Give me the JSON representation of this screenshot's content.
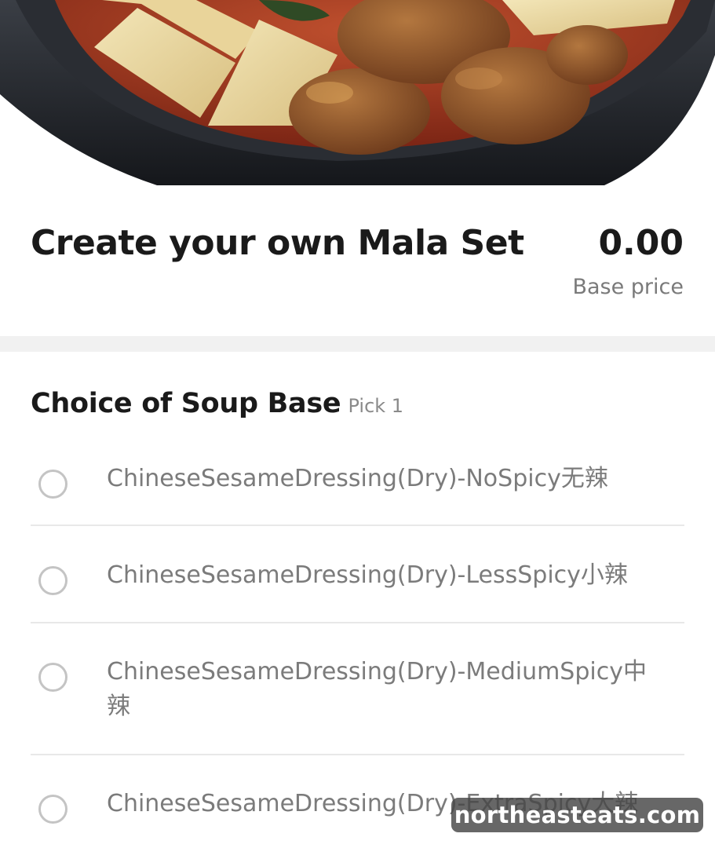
{
  "hero": {
    "image": "mala-hotpot-bowl-photo"
  },
  "item": {
    "title": "Create your own Mala Set",
    "price": "0.00",
    "price_caption": "Base price"
  },
  "soup_base": {
    "title": "Choice of Soup Base",
    "hint": "Pick 1",
    "options": [
      {
        "label": "ChineseSesameDressing(Dry)-NoSpicy无辣"
      },
      {
        "label": "ChineseSesameDressing(Dry)-LessSpicy小辣"
      },
      {
        "label": "ChineseSesameDressing(Dry)-MediumSpicy中辣"
      },
      {
        "label": "ChineseSesameDressing(Dry)-ExtraSpicy大辣"
      }
    ]
  },
  "watermark": {
    "text": "northeasteats.com"
  },
  "colors": {
    "radio_border": "#c4c4c4",
    "divider": "#e8e8e8",
    "section_gap": "#f1f1f1"
  }
}
